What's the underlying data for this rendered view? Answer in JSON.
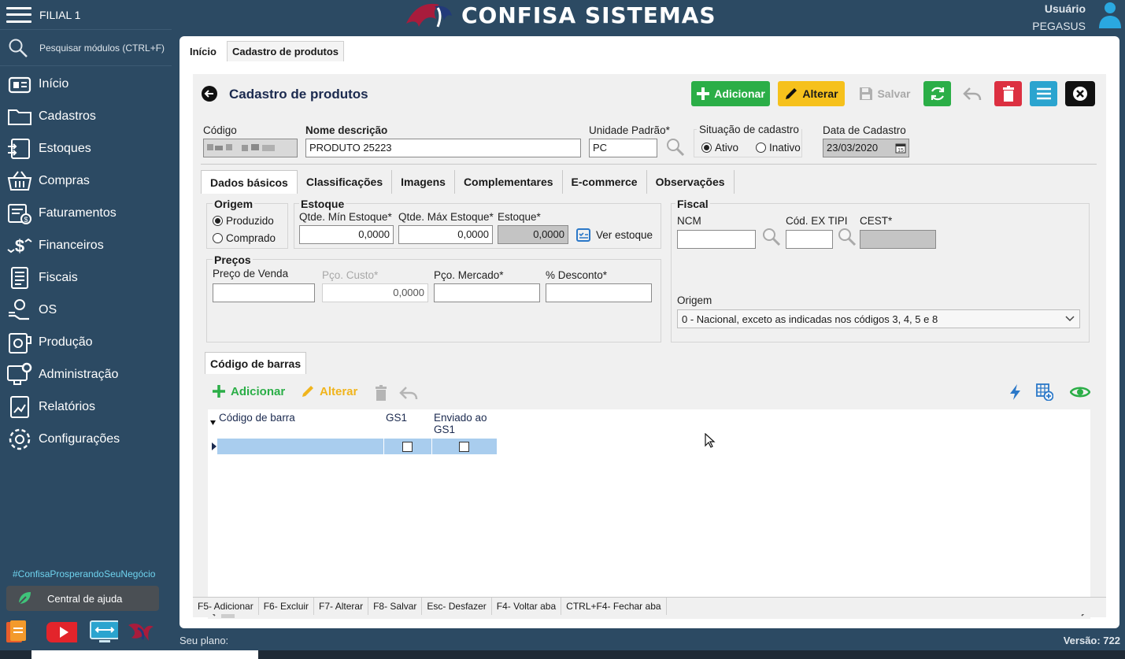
{
  "header": {
    "branch": "FILIAL 1",
    "logo_title": "CONFISA SISTEMAS",
    "user_label": "Usuário",
    "user_name": "PEGASUS"
  },
  "sidebar": {
    "search_placeholder": "Pesquisar módulos (CTRL+F)",
    "items": [
      {
        "label": "Início",
        "icon": "home-icon"
      },
      {
        "label": "Cadastros",
        "icon": "folder-icon"
      },
      {
        "label": "Estoques",
        "icon": "stock-icon"
      },
      {
        "label": "Compras",
        "icon": "basket-icon"
      },
      {
        "label": "Faturamentos",
        "icon": "invoice-icon"
      },
      {
        "label": "Financeiros",
        "icon": "dollar-icon"
      },
      {
        "label": "Fiscais",
        "icon": "document-icon"
      },
      {
        "label": "OS",
        "icon": "service-order-icon"
      },
      {
        "label": "Produção",
        "icon": "production-icon"
      },
      {
        "label": "Administração",
        "icon": "admin-icon"
      },
      {
        "label": "Relatórios",
        "icon": "report-icon"
      },
      {
        "label": "Configurações",
        "icon": "gear-icon"
      }
    ],
    "hashtag": "#ConfisaProsperandoSeuNegócio",
    "help_label": "Central de ajuda"
  },
  "top_tabs": [
    "Início",
    "Cadastro de produtos"
  ],
  "form": {
    "title": "Cadastro de produtos",
    "buttons": {
      "add": "Adicionar",
      "edit": "Alterar",
      "save": "Salvar"
    },
    "codigo_label": "Código",
    "nome_label": "Nome descrição",
    "nome_value": "PRODUTO 25223",
    "unidade_label": "Unidade Padrão*",
    "unidade_value": "PC",
    "situacao_label": "Situação de cadastro",
    "situacao_options": [
      "Ativo",
      "Inativo"
    ],
    "situacao_selected": "Ativo",
    "data_label": "Data de Cadastro",
    "data_value": "23/03/2020",
    "tabs": [
      "Dados básicos",
      "Classificações",
      "Imagens",
      "Complementares",
      "E-commerce",
      "Observações"
    ],
    "active_tab": "Dados básicos"
  },
  "dados_basicos": {
    "origem_title": "Origem",
    "origem_options": [
      "Produzido",
      "Comprado"
    ],
    "origem_selected": "Produzido",
    "estoque_title": "Estoque",
    "qtde_min_label": "Qtde. Mín Estoque*",
    "qtde_min_value": "0,0000",
    "qtde_max_label": "Qtde. Máx Estoque*",
    "qtde_max_value": "0,0000",
    "estoque_label": "Estoque*",
    "estoque_value": "0,0000",
    "ver_estoque": "Ver estoque",
    "precos_title": "Preços",
    "preco_venda_label": "Preço de Venda",
    "preco_venda_value": "",
    "pco_custo_label": "Pço. Custo*",
    "pco_custo_value": "0,0000",
    "pco_mercado_label": "Pço. Mercado*",
    "pco_mercado_value": "",
    "desconto_label": "% Desconto*",
    "desconto_value": "",
    "fiscal_title": "Fiscal",
    "ncm_label": "NCM",
    "ncm_value": "",
    "ex_tipi_label": "Cód. EX TIPI",
    "ex_tipi_value": "",
    "cest_label": "CEST*",
    "cest_value": "",
    "fiscal_origem_label": "Origem",
    "fiscal_origem_value": "0 - Nacional, exceto as indicadas nos códigos 3, 4, 5 e 8"
  },
  "barcode": {
    "tab_label": "Código de barras",
    "add_label": "Adicionar",
    "edit_label": "Alterar",
    "columns": [
      "Código de barra",
      "GS1",
      "Enviado ao GS1"
    ],
    "rows": [
      {
        "codigo": "",
        "gs1": false,
        "enviado": false
      }
    ]
  },
  "shortcuts": [
    "F5- Adicionar",
    "F6- Excluir",
    "F7- Alterar",
    "F8- Salvar",
    "Esc- Desfazer",
    "F4- Voltar aba",
    "CTRL+F4- Fechar aba"
  ],
  "footer": {
    "plan_label": "Seu plano:",
    "version": "Versão: 722"
  },
  "colors": {
    "sidebar_bg": "#2c4a63",
    "add_green": "#2bae47",
    "edit_yellow": "#f6c11c",
    "delete_red": "#dc3041",
    "menu_blue": "#2ba4cf",
    "title_navy": "#1b2a4f"
  }
}
